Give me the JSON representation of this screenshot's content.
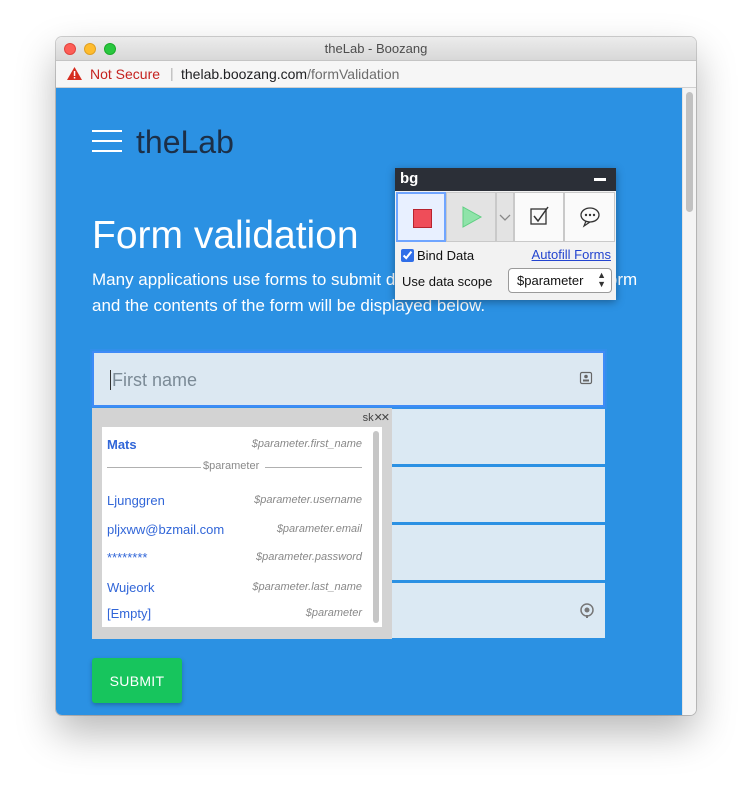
{
  "window": {
    "title": "theLab - Boozang"
  },
  "address": {
    "security_label": "Not Secure",
    "domain": "thelab.boozang.com",
    "path": "/formValidation"
  },
  "site": {
    "brand": "theLab"
  },
  "page": {
    "title": "Form validation",
    "intro": "Many applications use forms to submit data. Here you can submit a form and the contents of the form will be displayed below."
  },
  "form": {
    "first_name_placeholder": "First name",
    "submit_label": "SUBMIT"
  },
  "suggestions": {
    "header_text": "sk",
    "scope_divider": "$parameter",
    "items": [
      {
        "label": "Mats",
        "path": "$parameter.first_name"
      },
      {
        "label": "Ljunggren",
        "path": "$parameter.username"
      },
      {
        "label": "pljxww@bzmail.com",
        "path": "$parameter.email"
      },
      {
        "label": "********",
        "path": "$parameter.password"
      },
      {
        "label": "Wujeork",
        "path": "$parameter.last_name"
      },
      {
        "label": "[Empty]",
        "path": "$parameter"
      }
    ]
  },
  "boozang_toolbar": {
    "logo": "bg",
    "bind_data_label": "Bind Data",
    "bind_data_checked": true,
    "autofill_label": "Autofill Forms",
    "scope_label": "Use data scope",
    "scope_value": "$parameter"
  },
  "colors": {
    "page_bg": "#2b91e3",
    "brand_text": "#1c2f47",
    "submit_bg": "#17c55d",
    "record_red": "#ef4d59",
    "play_green": "#8fe3a9",
    "link_blue": "#3166d8"
  }
}
